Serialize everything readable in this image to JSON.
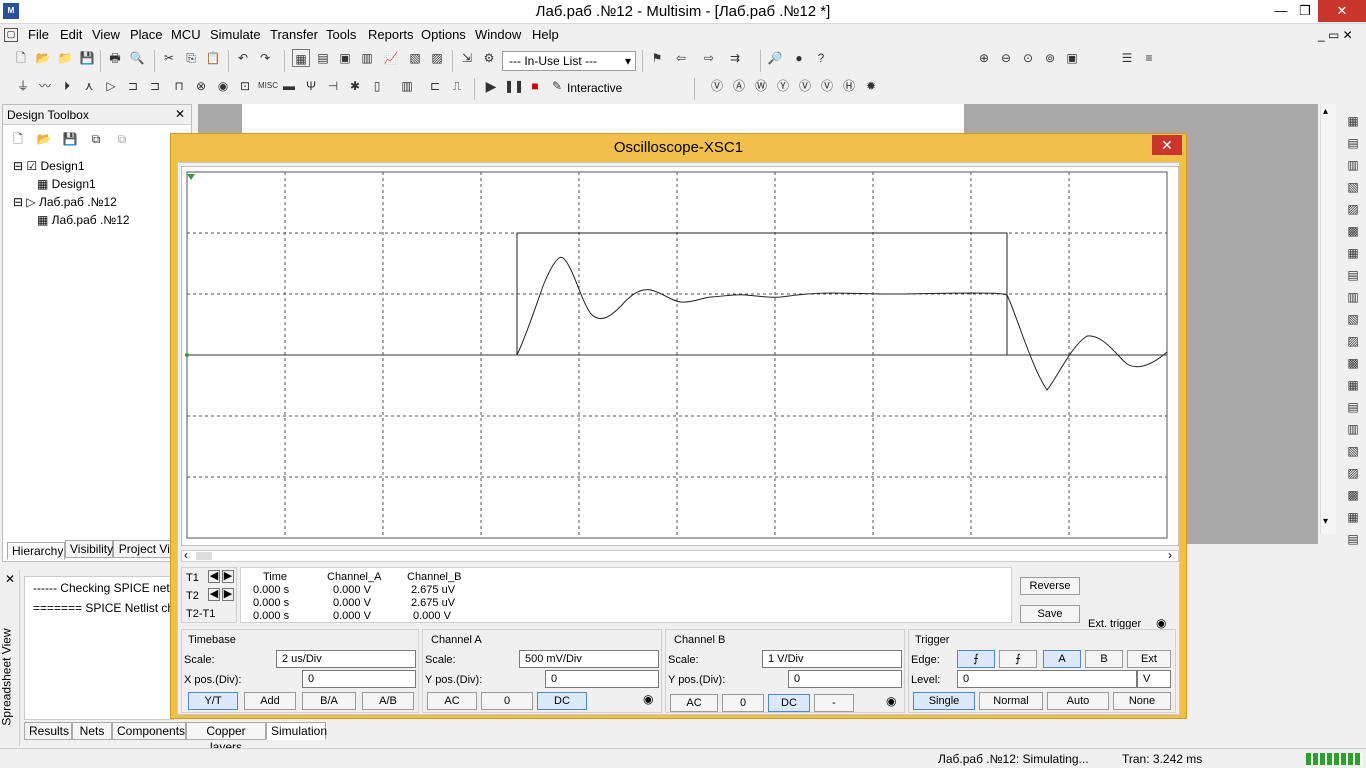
{
  "title": "Лаб.раб .№12 - Multisim - [Лаб.раб .№12 *]",
  "menu": [
    "File",
    "Edit",
    "View",
    "Place",
    "MCU",
    "Simulate",
    "Transfer",
    "Tools",
    "Reports",
    "Options",
    "Window",
    "Help"
  ],
  "toolbar": {
    "in_use_list": "--- In-Use List ---",
    "interactive": "Interactive"
  },
  "toolbox": {
    "title": "Design Toolbox",
    "tree": [
      "Design1",
      "Design1",
      "Лаб.раб .№12",
      "Лаб.раб .№12"
    ],
    "tabs": [
      "Hierarchy",
      "Visibility",
      "Project View"
    ]
  },
  "oscilloscope": {
    "title": "Oscilloscope-XSC1",
    "readout": {
      "headers": [
        "Time",
        "Channel_A",
        "Channel_B"
      ],
      "rows": [
        {
          "label": "T1",
          "time": "0.000 s",
          "a": "0.000 V",
          "b": "2.675 uV"
        },
        {
          "label": "T2",
          "time": "0.000 s",
          "a": "0.000 V",
          "b": "2.675 uV"
        },
        {
          "label": "T2-T1",
          "time": "0.000 s",
          "a": "0.000 V",
          "b": "0.000 V"
        }
      ]
    },
    "reverse": "Reverse",
    "save": "Save",
    "ext_trigger": "Ext. trigger",
    "timebase": {
      "title": "Timebase",
      "scale_label": "Scale:",
      "scale": "2 us/Div",
      "xpos_label": "X pos.(Div):",
      "xpos": "0",
      "buttons": [
        "Y/T",
        "Add",
        "B/A",
        "A/B"
      ]
    },
    "channel_a": {
      "title": "Channel A",
      "scale_label": "Scale:",
      "scale": "500 mV/Div",
      "ypos_label": "Y pos.(Div):",
      "ypos": "0",
      "buttons": [
        "AC",
        "0",
        "DC"
      ]
    },
    "channel_b": {
      "title": "Channel B",
      "scale_label": "Scale:",
      "scale": "1  V/Div",
      "ypos_label": "Y pos.(Div):",
      "ypos": "0",
      "buttons": [
        "AC",
        "0",
        "DC",
        "-"
      ]
    },
    "trigger": {
      "title": "Trigger",
      "edge_label": "Edge:",
      "level_label": "Level:",
      "level": "0",
      "unit": "V",
      "edge_buttons": [
        "A",
        "B",
        "Ext"
      ],
      "modes": [
        "Single",
        "Normal",
        "Auto",
        "None"
      ]
    }
  },
  "spreadsheet": {
    "side_label": "Spreadsheet View",
    "lines": [
      "------ Checking SPICE netlist",
      "======= SPICE Netlist check"
    ],
    "tabs": [
      "Results",
      "Nets",
      "Components",
      "Copper layers",
      "Simulation"
    ]
  },
  "status": {
    "left": "Лаб.раб .№12: Simulating...",
    "right": "Tran: 3.242 ms"
  }
}
